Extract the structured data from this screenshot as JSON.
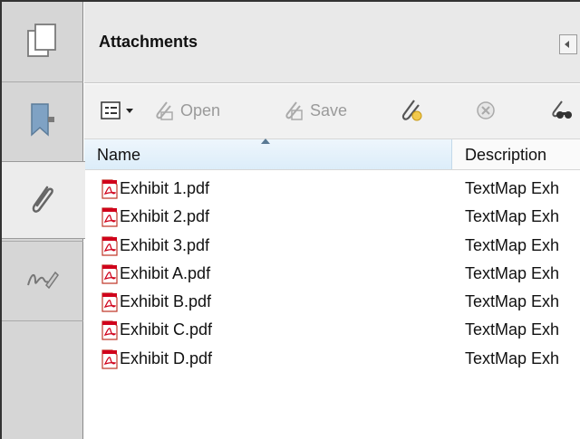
{
  "panel": {
    "title": "Attachments"
  },
  "toolbar": {
    "open_label": "Open",
    "save_label": "Save"
  },
  "columns": {
    "name": "Name",
    "description": "Description"
  },
  "attachments": [
    {
      "name": "Exhibit 1.pdf",
      "description": "TextMap Exh"
    },
    {
      "name": "Exhibit 2.pdf",
      "description": "TextMap Exh"
    },
    {
      "name": "Exhibit 3.pdf",
      "description": "TextMap Exh"
    },
    {
      "name": "Exhibit A.pdf",
      "description": "TextMap Exh"
    },
    {
      "name": "Exhibit B.pdf",
      "description": "TextMap Exh"
    },
    {
      "name": "Exhibit C.pdf",
      "description": "TextMap Exh"
    },
    {
      "name": "Exhibit D.pdf",
      "description": "TextMap Exh"
    }
  ],
  "colors": {
    "header_highlight": "#dcedf9",
    "pdf_red": "#d0021b",
    "rail_bg": "#d6d6d6"
  }
}
